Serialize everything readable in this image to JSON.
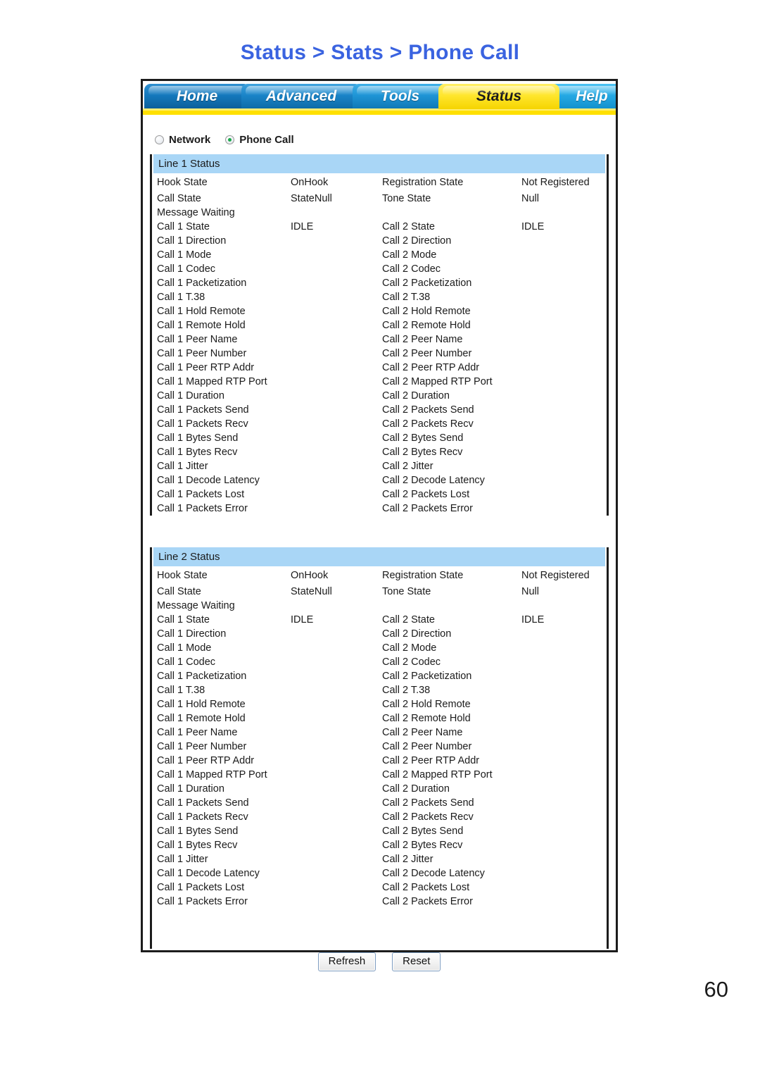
{
  "page_title": "Status > Stats > Phone Call",
  "page_number": "60",
  "title_color": "#3a63e0",
  "nav_tabs": [
    {
      "label": "Home",
      "active": false
    },
    {
      "label": "Advanced",
      "active": false
    },
    {
      "label": "Tools",
      "active": false
    },
    {
      "label": "Status",
      "active": true
    },
    {
      "label": "Help",
      "active": false
    }
  ],
  "stats_selector": {
    "options": [
      {
        "label": "Network",
        "selected": false
      },
      {
        "label": "Phone Call",
        "selected": true
      }
    ]
  },
  "sections": [
    {
      "heading": "Line 1 Status",
      "rows": [
        {
          "label1": "Hook State",
          "value1": "OnHook",
          "label2": "Registration State",
          "value2": "Not Registered"
        },
        {
          "label1": "Call State",
          "value1": "StateNull",
          "label2": "Tone State",
          "value2": "Null"
        },
        {
          "label1": "Message Waiting",
          "value1": "",
          "label2": "",
          "value2": ""
        },
        {
          "label1": "Call 1 State",
          "value1": "IDLE",
          "label2": "Call 2 State",
          "value2": "IDLE"
        },
        {
          "label1": "Call 1 Direction",
          "value1": "",
          "label2": "Call 2 Direction",
          "value2": ""
        },
        {
          "label1": "Call 1 Mode",
          "value1": "",
          "label2": "Call 2 Mode",
          "value2": ""
        },
        {
          "label1": "Call 1 Codec",
          "value1": "",
          "label2": "Call 2 Codec",
          "value2": ""
        },
        {
          "label1": "Call 1 Packetization",
          "value1": "",
          "label2": "Call 2 Packetization",
          "value2": ""
        },
        {
          "label1": "Call 1 T.38",
          "value1": "",
          "label2": "Call 2 T.38",
          "value2": ""
        },
        {
          "label1": "Call 1 Hold Remote",
          "value1": "",
          "label2": "Call 2 Hold Remote",
          "value2": ""
        },
        {
          "label1": "Call 1 Remote Hold",
          "value1": "",
          "label2": "Call 2 Remote Hold",
          "value2": ""
        },
        {
          "label1": "Call 1 Peer Name",
          "value1": "",
          "label2": "Call 2 Peer Name",
          "value2": ""
        },
        {
          "label1": "Call 1 Peer Number",
          "value1": "",
          "label2": "Call 2 Peer Number",
          "value2": ""
        },
        {
          "label1": "Call 1 Peer RTP Addr",
          "value1": "",
          "label2": "Call 2 Peer RTP Addr",
          "value2": ""
        },
        {
          "label1": "Call 1 Mapped RTP Port",
          "value1": "",
          "label2": "Call 2 Mapped RTP Port",
          "value2": ""
        },
        {
          "label1": "Call 1 Duration",
          "value1": "",
          "label2": "Call 2 Duration",
          "value2": ""
        },
        {
          "label1": "Call 1 Packets Send",
          "value1": "",
          "label2": "Call 2 Packets Send",
          "value2": ""
        },
        {
          "label1": "Call 1 Packets Recv",
          "value1": "",
          "label2": "Call 2 Packets Recv",
          "value2": ""
        },
        {
          "label1": "Call 1 Bytes Send",
          "value1": "",
          "label2": "Call 2 Bytes Send",
          "value2": ""
        },
        {
          "label1": "Call 1 Bytes Recv",
          "value1": "",
          "label2": "Call 2 Bytes Recv",
          "value2": ""
        },
        {
          "label1": "Call 1 Jitter",
          "value1": "",
          "label2": "Call 2 Jitter",
          "value2": ""
        },
        {
          "label1": "Call 1 Decode Latency",
          "value1": "",
          "label2": "Call 2 Decode Latency",
          "value2": ""
        },
        {
          "label1": "Call 1 Packets Lost",
          "value1": "",
          "label2": "Call 2 Packets Lost",
          "value2": ""
        },
        {
          "label1": "Call 1 Packets Error",
          "value1": "",
          "label2": "Call 2 Packets Error",
          "value2": ""
        }
      ]
    },
    {
      "heading": "Line 2 Status",
      "rows": [
        {
          "label1": "Hook State",
          "value1": "OnHook",
          "label2": "Registration State",
          "value2": "Not Registered"
        },
        {
          "label1": "Call State",
          "value1": "StateNull",
          "label2": "Tone State",
          "value2": "Null"
        },
        {
          "label1": "Message Waiting",
          "value1": "",
          "label2": "",
          "value2": ""
        },
        {
          "label1": "Call 1 State",
          "value1": "IDLE",
          "label2": "Call 2 State",
          "value2": "IDLE"
        },
        {
          "label1": "Call 1 Direction",
          "value1": "",
          "label2": "Call 2 Direction",
          "value2": ""
        },
        {
          "label1": "Call 1 Mode",
          "value1": "",
          "label2": "Call 2 Mode",
          "value2": ""
        },
        {
          "label1": "Call 1 Codec",
          "value1": "",
          "label2": "Call 2 Codec",
          "value2": ""
        },
        {
          "label1": "Call 1 Packetization",
          "value1": "",
          "label2": "Call 2 Packetization",
          "value2": ""
        },
        {
          "label1": "Call 1 T.38",
          "value1": "",
          "label2": "Call 2 T.38",
          "value2": ""
        },
        {
          "label1": "Call 1 Hold Remote",
          "value1": "",
          "label2": "Call 2 Hold Remote",
          "value2": ""
        },
        {
          "label1": "Call 1 Remote Hold",
          "value1": "",
          "label2": "Call 2 Remote Hold",
          "value2": ""
        },
        {
          "label1": "Call 1 Peer Name",
          "value1": "",
          "label2": "Call 2 Peer Name",
          "value2": ""
        },
        {
          "label1": "Call 1 Peer Number",
          "value1": "",
          "label2": "Call 2 Peer Number",
          "value2": ""
        },
        {
          "label1": "Call 1 Peer RTP Addr",
          "value1": "",
          "label2": "Call 2 Peer RTP Addr",
          "value2": ""
        },
        {
          "label1": "Call 1 Mapped RTP Port",
          "value1": "",
          "label2": "Call 2 Mapped RTP Port",
          "value2": ""
        },
        {
          "label1": "Call 1 Duration",
          "value1": "",
          "label2": "Call 2 Duration",
          "value2": ""
        },
        {
          "label1": "Call 1 Packets Send",
          "value1": "",
          "label2": "Call 2 Packets Send",
          "value2": ""
        },
        {
          "label1": "Call 1 Packets Recv",
          "value1": "",
          "label2": "Call 2 Packets Recv",
          "value2": ""
        },
        {
          "label1": "Call 1 Bytes Send",
          "value1": "",
          "label2": "Call 2 Bytes Send",
          "value2": ""
        },
        {
          "label1": "Call 1 Bytes Recv",
          "value1": "",
          "label2": "Call 2 Bytes Recv",
          "value2": ""
        },
        {
          "label1": "Call 1 Jitter",
          "value1": "",
          "label2": "Call 2 Jitter",
          "value2": ""
        },
        {
          "label1": "Call 1 Decode Latency",
          "value1": "",
          "label2": "Call 2 Decode Latency",
          "value2": ""
        },
        {
          "label1": "Call 1 Packets Lost",
          "value1": "",
          "label2": "Call 2 Packets Lost",
          "value2": ""
        },
        {
          "label1": "Call 1 Packets Error",
          "value1": "",
          "label2": "Call 2 Packets Error",
          "value2": ""
        }
      ]
    }
  ],
  "buttons": [
    {
      "label": "Refresh"
    },
    {
      "label": "Reset"
    }
  ],
  "colors": {
    "title_blue": "#3a63e0",
    "section_band": "#a9d6f6",
    "tab_active_yellow": "#ffe62e",
    "tab_inactive_blue": "#1a84c8",
    "frame_border": "#1c1c1c",
    "radio_selected_dot": "#1aa84a"
  }
}
